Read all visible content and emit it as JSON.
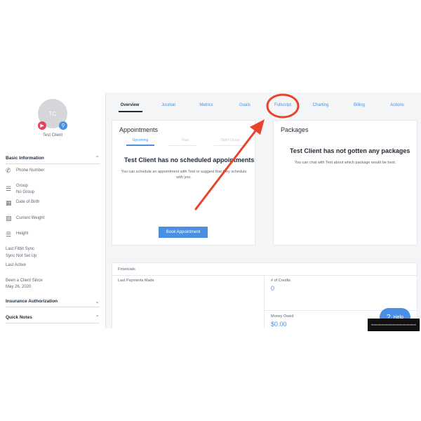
{
  "client": {
    "initials": "TC",
    "name": "Test Client"
  },
  "sidebar": {
    "basic_info_title": "Basic Information",
    "phone_label": "Phone Number",
    "group_label": "Group",
    "group_value": "No Group",
    "dob_label": "Date of Birth",
    "weight_label": "Current Weight",
    "height_label": "Height",
    "fitbit_label": "Last Fitbit Sync",
    "fitbit_value": "Sync Not Set Up",
    "last_active_label": "Last Active",
    "client_since_label": "Been a Client Since",
    "client_since_value": "May 26, 2020",
    "insurance_title": "Insurance Authorization",
    "quick_notes_title": "Quick Notes"
  },
  "tabs": [
    {
      "label": "Overview"
    },
    {
      "label": "Journal"
    },
    {
      "label": "Metrics"
    },
    {
      "label": "Goals"
    },
    {
      "label": "Fullscript"
    },
    {
      "label": "Charting"
    },
    {
      "label": "Billing"
    },
    {
      "label": "Actions"
    }
  ],
  "appointments": {
    "title": "Appointments",
    "subtabs": [
      "Upcoming",
      "Past",
      "Didn't Occur"
    ],
    "empty_title": "Test Client has no scheduled appointments",
    "empty_text": "You can schedule an appointment with Test or suggest that they schedule with you.",
    "book_button": "Book Appointment"
  },
  "packages": {
    "title": "Packages",
    "empty_title": "Test Client has not gotten any packages",
    "empty_text": "You can chat with Test about which package would be best."
  },
  "financials": {
    "title": "Financials",
    "last_payments_label": "Last Payments Made",
    "credits_label": "# of Credits",
    "credits_value": "0",
    "money_owed_label": "Money Owed",
    "money_owed_value": "$0.00"
  },
  "help": {
    "label": "Help"
  },
  "colors": {
    "accent": "#4a90e2",
    "annotation": "#e8442c"
  }
}
